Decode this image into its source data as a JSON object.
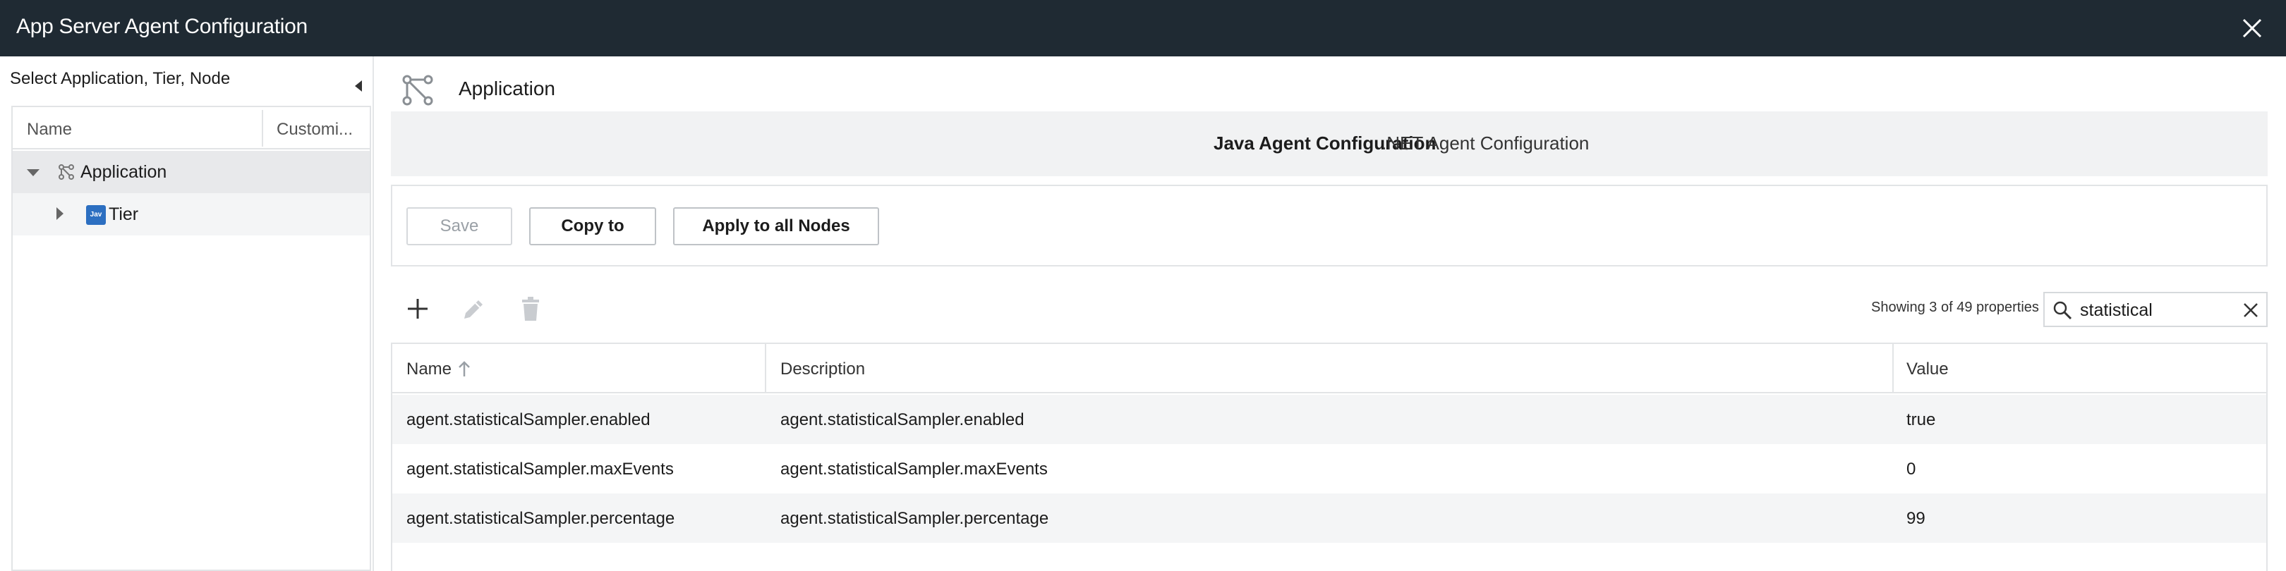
{
  "window": {
    "title": "App Server Agent Configuration"
  },
  "left_panel": {
    "heading": "Select Application, Tier, Node",
    "tree": {
      "columns": [
        "Name",
        "Customi..."
      ],
      "items": [
        {
          "label": "Application",
          "icon": "application-node-icon",
          "expanded": true
        },
        {
          "label": "Tier",
          "icon": "java-tier-icon",
          "icon_text": "Jav",
          "expanded": false
        }
      ]
    }
  },
  "main": {
    "title": "Application",
    "tabs": [
      {
        "label": "Java Agent Configuration",
        "active": true
      },
      {
        "label": ".NET Agent Configuration",
        "active": false
      }
    ],
    "actions": {
      "save_label": "Save",
      "copy_label": "Copy to",
      "apply_label": "Apply to all Nodes"
    },
    "toolbar": {
      "icons": [
        "add-icon",
        "edit-icon",
        "delete-icon"
      ]
    },
    "showing_text": "Showing 3 of 49 properties",
    "search": {
      "value": "statistical",
      "icon": "search-icon"
    },
    "table": {
      "headers": [
        "Name",
        "Description",
        "Value"
      ],
      "sort": {
        "column": "Name",
        "direction": "ascending"
      },
      "rows": [
        {
          "name": "agent.statisticalSampler.enabled",
          "description": "agent.statisticalSampler.enabled",
          "value": "true"
        },
        {
          "name": "agent.statisticalSampler.maxEvents",
          "description": "agent.statisticalSampler.maxEvents",
          "value": "0"
        },
        {
          "name": "agent.statisticalSampler.percentage",
          "description": "agent.statisticalSampler.percentage",
          "value": "99"
        }
      ]
    }
  },
  "colors": {
    "titlebar": "#1f2a33",
    "selected_row": "#e8e9eb",
    "tab_strip": "#f1f2f3",
    "java_icon": "#2c6fc1"
  }
}
